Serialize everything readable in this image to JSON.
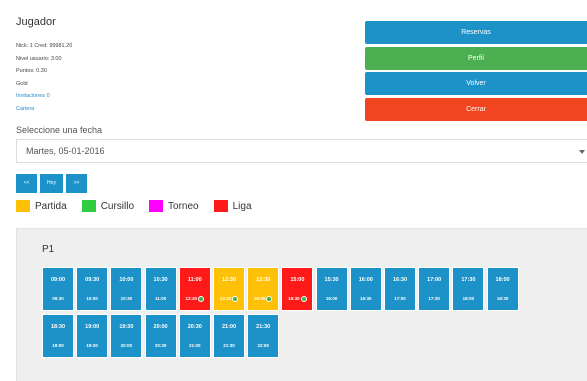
{
  "player": {
    "title": "Jugador",
    "lines": [
      "Nick: 1 Cred: 99981.20",
      "Nivel usuario: 3.00",
      "Puntos: 0.30",
      "Gold"
    ],
    "links": [
      "Invitaciones 0",
      "Cartera"
    ]
  },
  "actions": [
    {
      "label": "Reservas",
      "color": "#1c92c9"
    },
    {
      "label": "Perfil",
      "color": "#4caf50"
    },
    {
      "label": "Volver",
      "color": "#1c92c9"
    },
    {
      "label": "Cerrar",
      "color": "#f0451f"
    }
  ],
  "date": {
    "label": "Seleccione una fecha",
    "selected": "Martes, 05-01-2016"
  },
  "nav": [
    {
      "label": "<<"
    },
    {
      "label": "Hoy"
    },
    {
      "label": ">>"
    }
  ],
  "legend": [
    {
      "label": "Partida",
      "color": "#ffc107"
    },
    {
      "label": "Cursillo",
      "color": "#2ecc40"
    },
    {
      "label": "Torneo",
      "color": "#ff00ff"
    },
    {
      "label": "Liga",
      "color": "#ff1a1a"
    }
  ],
  "court": {
    "title": "P1",
    "slots": [
      {
        "start": "09:00",
        "end": "09:30",
        "color": "#1c92c9",
        "dot": false
      },
      {
        "start": "09:30",
        "end": "10:00",
        "color": "#1c92c9",
        "dot": false
      },
      {
        "start": "10:00",
        "end": "10:30",
        "color": "#1c92c9",
        "dot": false
      },
      {
        "start": "10:30",
        "end": "11:00",
        "color": "#1c92c9",
        "dot": false
      },
      {
        "start": "11:00",
        "end": "12:30",
        "color": "#ff1a1a",
        "dot": true
      },
      {
        "start": "12:30",
        "end": "13:30",
        "color": "#ffc107",
        "dot": true
      },
      {
        "start": "13:30",
        "end": "15:00",
        "color": "#ffc107",
        "dot": true
      },
      {
        "start": "15:00",
        "end": "16:30",
        "color": "#ff1a1a",
        "dot": true
      },
      {
        "start": "15:30",
        "end": "16:00",
        "color": "#1c92c9",
        "dot": false
      },
      {
        "start": "16:00",
        "end": "16:30",
        "color": "#1c92c9",
        "dot": false
      },
      {
        "start": "16:30",
        "end": "17:00",
        "color": "#1c92c9",
        "dot": false
      },
      {
        "start": "17:00",
        "end": "17:30",
        "color": "#1c92c9",
        "dot": false
      },
      {
        "start": "17:30",
        "end": "18:00",
        "color": "#1c92c9",
        "dot": false
      },
      {
        "start": "18:00",
        "end": "18:30",
        "color": "#1c92c9",
        "dot": false
      },
      {
        "start": "18:30",
        "end": "19:00",
        "color": "#1c92c9",
        "dot": false
      },
      {
        "start": "19:00",
        "end": "19:30",
        "color": "#1c92c9",
        "dot": false
      },
      {
        "start": "19:30",
        "end": "20:00",
        "color": "#1c92c9",
        "dot": false
      },
      {
        "start": "20:00",
        "end": "20:30",
        "color": "#1c92c9",
        "dot": false
      },
      {
        "start": "20:30",
        "end": "21:00",
        "color": "#1c92c9",
        "dot": false
      },
      {
        "start": "21:00",
        "end": "21:30",
        "color": "#1c92c9",
        "dot": false
      },
      {
        "start": "21:30",
        "end": "22:00",
        "color": "#1c92c9",
        "dot": false
      }
    ]
  }
}
